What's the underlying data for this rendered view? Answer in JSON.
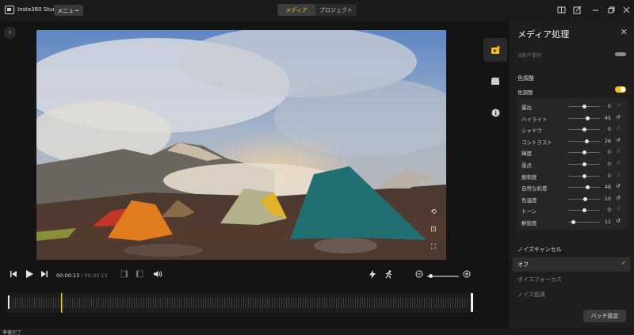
{
  "app": {
    "title": "Insta360 Studio",
    "menu_label": "メニュー",
    "tabs": [
      {
        "label": "メディア",
        "active": true
      },
      {
        "label": "プロジェクト",
        "active": false
      }
    ]
  },
  "player": {
    "current_time": "00:00:13",
    "separator": " / ",
    "duration": "00:00:13",
    "zoom_level": 0.1
  },
  "panel": {
    "title": "メディア処理",
    "cut_off_label": "自動不要物",
    "color_section": "色調整",
    "color_toggle_label": "色調整",
    "color_enabled": true,
    "adjustments": [
      {
        "label": "露出",
        "value": "0",
        "level": 0.5,
        "modified": false
      },
      {
        "label": "ハイライト",
        "value": "45",
        "level": 0.62,
        "modified": true
      },
      {
        "label": "シャドウ",
        "value": "0",
        "level": 0.5,
        "modified": false
      },
      {
        "label": "コントラスト",
        "value": "26",
        "level": 0.58,
        "modified": true
      },
      {
        "label": "輝度",
        "value": "0",
        "level": 0.5,
        "modified": false
      },
      {
        "label": "黒点",
        "value": "0",
        "level": 0.5,
        "modified": false
      },
      {
        "label": "飽和度",
        "value": "0",
        "level": 0.5,
        "modified": false
      },
      {
        "label": "自然な彩度",
        "value": "48",
        "level": 0.62,
        "modified": true
      },
      {
        "label": "色温度",
        "value": "10",
        "level": 0.53,
        "modified": true
      },
      {
        "label": "トーン",
        "value": "0",
        "level": 0.5,
        "modified": false
      },
      {
        "label": "鮮鋭度",
        "value": "11",
        "level": 0.15,
        "modified": true
      }
    ],
    "noise_section": "ノイズキャンセル",
    "noise_options": [
      {
        "label": "オフ",
        "selected": true
      },
      {
        "label": "ボイスフォーカス",
        "selected": false
      },
      {
        "label": "ノイズ低減",
        "selected": false
      }
    ],
    "batch_button": "バッチ設定"
  },
  "status": {
    "text": "準備完了"
  },
  "colors": {
    "accent": "#f2c318",
    "background": "#141414",
    "panel": "#1e1e1e"
  },
  "icons": {
    "sidebar": [
      "media-process-icon",
      "clip-icon",
      "info-icon"
    ],
    "playback": [
      "skip-back-icon",
      "play-icon",
      "skip-forward-icon",
      "frame-icon",
      "volume-icon"
    ],
    "tools": [
      "flash-icon",
      "run-icon",
      "zoom-out-icon",
      "zoom-in-icon",
      "export-icon"
    ]
  }
}
